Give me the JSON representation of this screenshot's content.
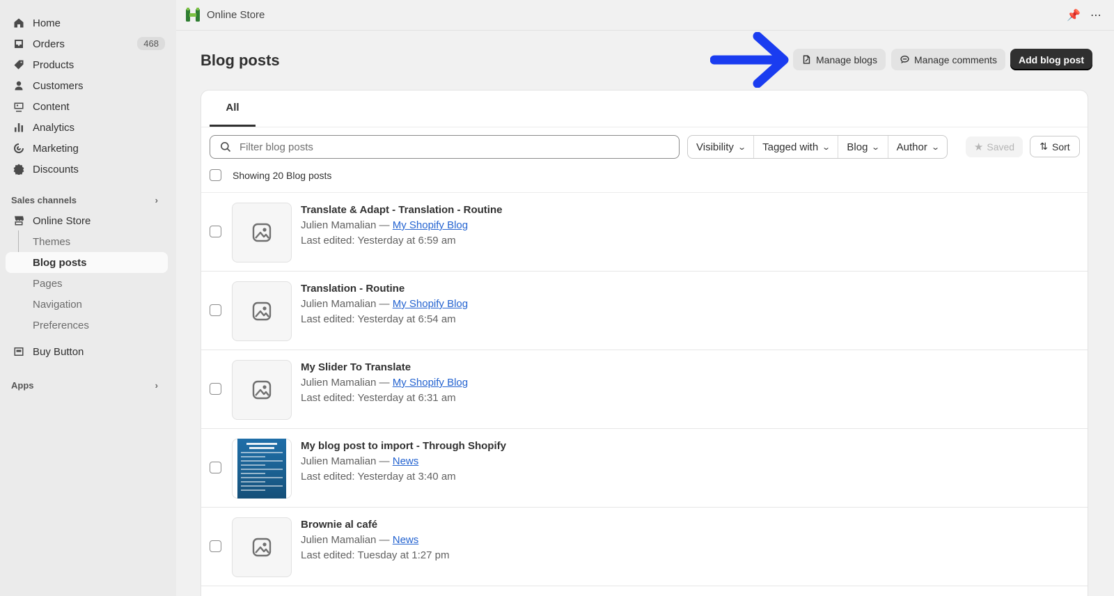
{
  "sidebar": {
    "items": [
      {
        "label": "Home",
        "icon": "home-icon"
      },
      {
        "label": "Orders",
        "icon": "inbox-icon",
        "badge": "468"
      },
      {
        "label": "Products",
        "icon": "tag-icon"
      },
      {
        "label": "Customers",
        "icon": "person-icon"
      },
      {
        "label": "Content",
        "icon": "image-icon"
      },
      {
        "label": "Analytics",
        "icon": "bar-chart-icon"
      },
      {
        "label": "Marketing",
        "icon": "target-icon"
      },
      {
        "label": "Discounts",
        "icon": "discount-icon"
      }
    ],
    "sales_channels_label": "Sales channels",
    "online_store": "Online Store",
    "sub_items": [
      "Themes",
      "Blog posts",
      "Pages",
      "Navigation",
      "Preferences"
    ],
    "buy_button": "Buy Button",
    "apps_label": "Apps"
  },
  "topbar": {
    "title": "Online Store"
  },
  "page": {
    "title": "Blog posts",
    "manage_blogs": "Manage blogs",
    "manage_comments": "Manage comments",
    "add_blog_post": "Add blog post"
  },
  "tabs": [
    "All"
  ],
  "filters": {
    "search_placeholder": "Filter blog posts",
    "buttons": [
      "Visibility",
      "Tagged with",
      "Blog",
      "Author"
    ],
    "saved": "Saved",
    "sort": "Sort"
  },
  "showing": "Showing 20 Blog posts",
  "posts": [
    {
      "title": "Translate & Adapt - Translation - Routine",
      "author": "Julien Mamalian —",
      "blog": "My Shopify Blog",
      "edited": "Last edited: Yesterday at 6:59 am"
    },
    {
      "title": "Translation - Routine",
      "author": "Julien Mamalian —",
      "blog": "My Shopify Blog",
      "edited": "Last edited: Yesterday at 6:54 am"
    },
    {
      "title": "My Slider To Translate",
      "author": "Julien Mamalian —",
      "blog": "My Shopify Blog",
      "edited": "Last edited: Yesterday at 6:31 am"
    },
    {
      "title": "My blog post to import - Through Shopify",
      "author": "Julien Mamalian —",
      "blog": "News",
      "edited": "Last edited: Yesterday at 3:40 am"
    },
    {
      "title": "Brownie al café",
      "author": "Julien Mamalian —",
      "blog": "News",
      "edited": "Last edited: Tuesday at 1:27 pm"
    }
  ],
  "colors": {
    "accent_arrow": "#1a3cf0",
    "primary_button": "#303030",
    "link": "#2463d0"
  }
}
